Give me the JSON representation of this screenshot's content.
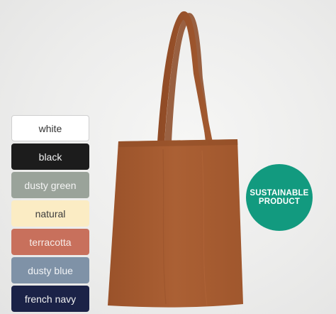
{
  "colors": {
    "bag": "#a85e33",
    "badge": "#129a7f"
  },
  "swatches": [
    {
      "label": "white"
    },
    {
      "label": "black"
    },
    {
      "label": "dusty green"
    },
    {
      "label": "natural"
    },
    {
      "label": "terracotta"
    },
    {
      "label": "dusty blue"
    },
    {
      "label": "french navy"
    }
  ],
  "badge": {
    "line1": "SUSTAINABLE",
    "line2": "PRODUCT"
  },
  "product": {
    "icon": "tote-bag-icon"
  }
}
